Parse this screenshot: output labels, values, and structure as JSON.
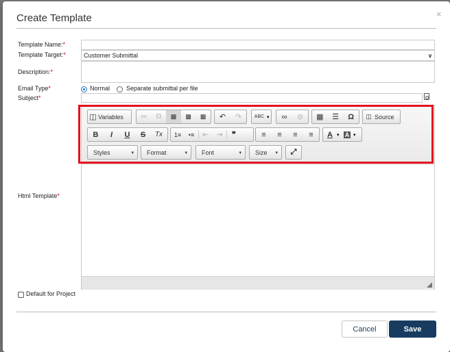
{
  "dialog": {
    "title": "Create Template",
    "close_glyph": "×"
  },
  "form": {
    "template_name": {
      "label": "Template Name:",
      "required": "*",
      "value": ""
    },
    "template_target": {
      "label": "Template Target:",
      "required": "*",
      "value": "Customer Submittal"
    },
    "description": {
      "label": "Description:",
      "required": "*",
      "value": ""
    },
    "email_type": {
      "label": "Email Type",
      "required": "*",
      "options": [
        "Normal",
        "Separate submittal per file"
      ],
      "selected": "Normal"
    },
    "subject": {
      "label": "Subject",
      "required": "*",
      "value": ""
    },
    "html_template": {
      "label": "Html Template",
      "required": "*"
    },
    "default_for_project": {
      "label": "Default for Project",
      "checked": false
    }
  },
  "editor": {
    "toolbar": {
      "variables_label": "Variables",
      "source_label": "Source",
      "combos": {
        "styles": "Styles",
        "format": "Format",
        "font": "Font",
        "size": "Size"
      },
      "icons": {
        "cut": "✂",
        "copy": "⧉",
        "paste": "📋",
        "undo": "↶",
        "redo": "↷",
        "spell": "ABC",
        "link": "∞",
        "unlink": "⊘",
        "table": "▦",
        "hr": "☰",
        "special": "Ω",
        "bold": "B",
        "italic": "I",
        "underline": "U",
        "strike": "S",
        "clear": "Tx",
        "olist": "1≡",
        "ulist": "•≡",
        "outdent": "⇤",
        "indent": "⇥",
        "quote": "❞",
        "align_left": "≡",
        "align_center": "≡",
        "align_right": "≡",
        "justify": "≡",
        "text_color": "A",
        "bg_color": "A",
        "maximize": "⤢"
      }
    }
  },
  "buttons": {
    "cancel": "Cancel",
    "save": "Save"
  },
  "colors": {
    "primary": "#173c5f",
    "required": "#d0021b",
    "highlight": "#e3121e",
    "radio": "#1a73c9"
  }
}
